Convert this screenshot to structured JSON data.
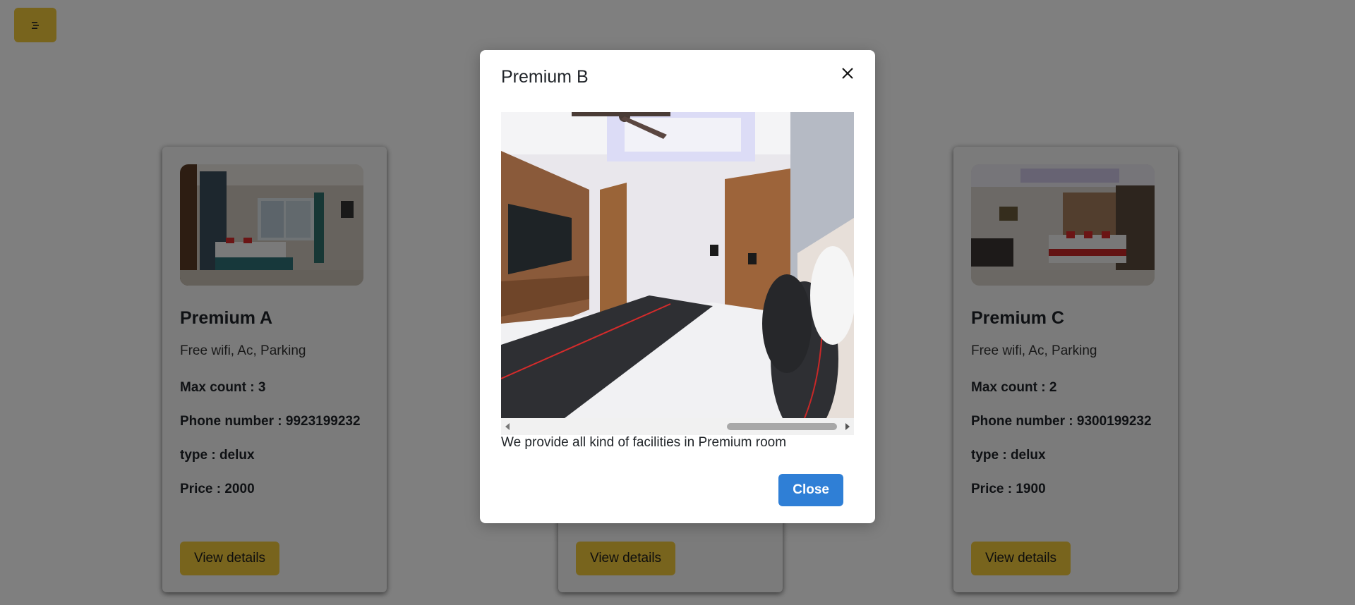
{
  "menu": {
    "icon": "menu-icon"
  },
  "cards": [
    {
      "name": "Premium A",
      "facilities": "Free wifi, Ac, Parking",
      "max_count": "Max count : 3",
      "phone": "Phone number : 9923199232",
      "type": "type : delux",
      "price": "Price : 2000",
      "button": "View details"
    },
    {
      "button": "View details"
    },
    {
      "name": "Premium C",
      "facilities": "Free wifi, Ac, Parking",
      "max_count": "Max count : 2",
      "phone": "Phone number : 9300199232",
      "type": "type : delux",
      "price": "Price : 1900",
      "button": "View details"
    }
  ],
  "modal": {
    "title": "Premium B",
    "description": "We provide all kind of facilities in Premium room",
    "close_button": "Close",
    "close_icon": "close-icon"
  },
  "colors": {
    "accent": "#f0c93a",
    "primary": "#2f7fd6"
  }
}
